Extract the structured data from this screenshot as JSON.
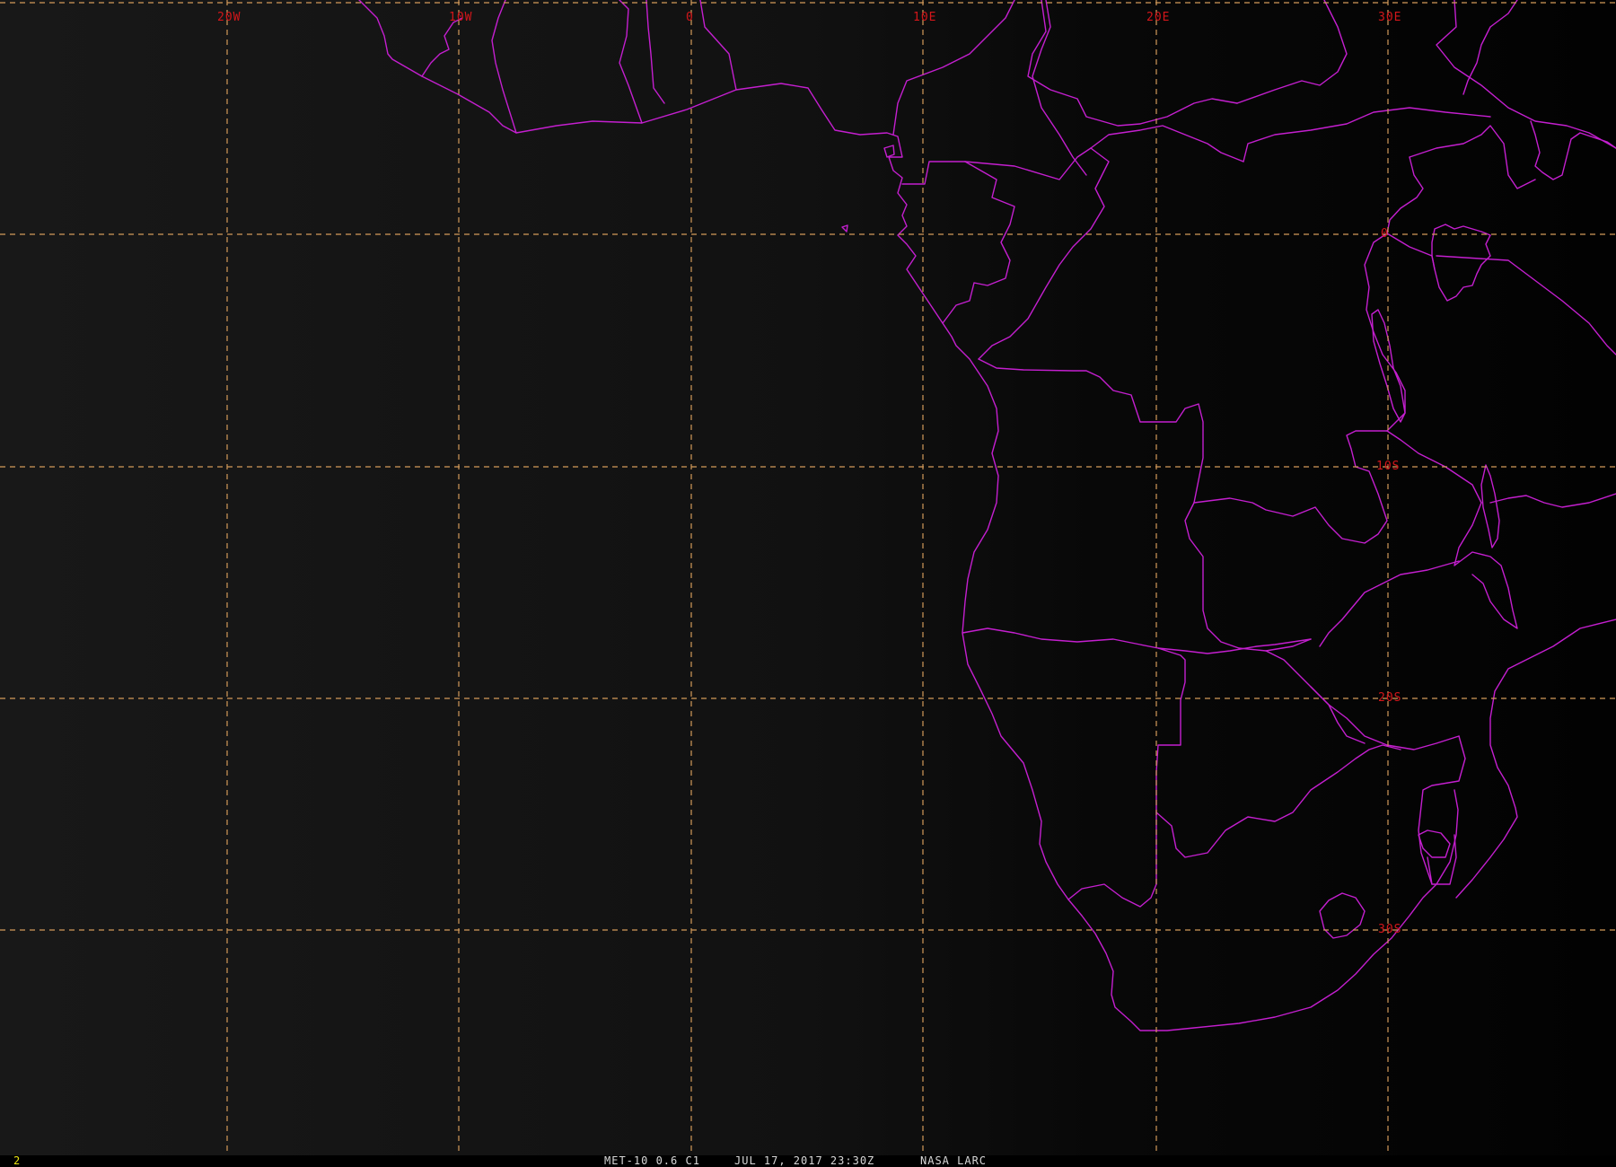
{
  "viewer": {
    "background_colors": {
      "ocean_west": "#181818",
      "ocean_mid": "#0f0f0f",
      "night_east": "#020202"
    },
    "grid_color": "#d39a5a",
    "border_color": "#c41fcf",
    "label_color": "#d4161a"
  },
  "grid_labels": {
    "lon_20w": "20W",
    "lon_10w": "10W",
    "lon_0": "0",
    "lon_10e": "10E",
    "lon_20e": "20E",
    "lon_30e": "30E",
    "lat_0": "0",
    "lat_10s": "10S",
    "lat_20s": "20S",
    "lat_30s": "30S"
  },
  "status": {
    "frame_number": "2",
    "product": "MET-10 0.6 C1",
    "datetime": "JUL 17, 2017 23:30Z",
    "source": "NASA LARC"
  }
}
